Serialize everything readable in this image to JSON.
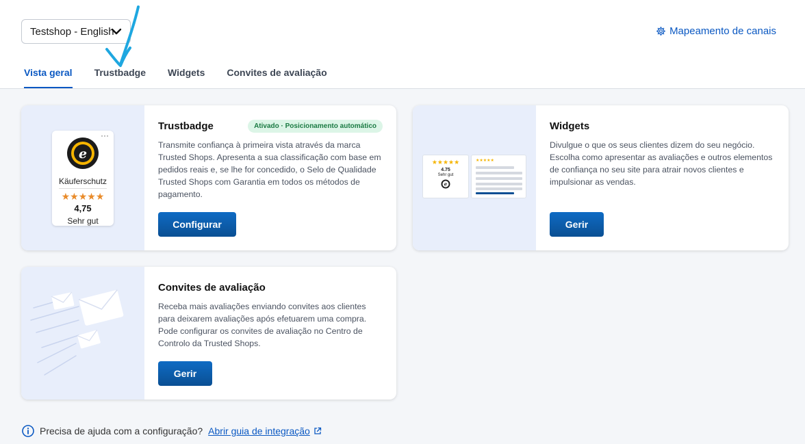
{
  "header": {
    "shop_select": "Testshop - English",
    "channel_mapping": "Mapeamento de canais"
  },
  "tabs": [
    {
      "label": "Vista geral",
      "active": true
    },
    {
      "label": "Trustbadge",
      "active": false
    },
    {
      "label": "Widgets",
      "active": false
    },
    {
      "label": "Convites de avaliação",
      "active": false
    }
  ],
  "cards": {
    "trustbadge": {
      "title": "Trustbadge",
      "badge": "Ativado · Posicionamento automático",
      "description": "Transmite confiança à primeira vista através da marca Trusted Shops. Apresenta a sua classificação com base em pedidos reais e, se lhe for concedido, o Selo de Qualidade Trusted Shops com Garantia em todos os métodos de pagamento.",
      "button": "Configurar",
      "preview": {
        "label": "Käuferschutz",
        "stars": "★★★★★",
        "score": "4,75",
        "rating": "Sehr gut"
      }
    },
    "widgets": {
      "title": "Widgets",
      "description": "Divulgue o que os seus clientes dizem do seu negócio. Escolha como apresentar as avaliações e outros elementos de confiança no seu site para atrair novos clientes e impulsionar as vendas.",
      "button": "Gerir",
      "preview": {
        "stars": "★★★★★",
        "score": "4.75",
        "rating": "Sehr gut"
      }
    },
    "invites": {
      "title": "Convites de avaliação",
      "description": "Receba mais avaliações enviando convites aos clientes para deixarem avaliações após efetuarem uma compra. Pode configurar os convites de avaliação no Centro de Controlo da Trusted Shops.",
      "button": "Gerir"
    }
  },
  "help": {
    "text": "Precisa de ajuda com a configuração?",
    "link": "Abrir guia de integração"
  },
  "colors": {
    "accent": "#0a58c2",
    "button": "#0a4f93",
    "badge_bg": "#dcf5e7",
    "badge_text": "#1b7a43",
    "visual_bg": "#e8eefb",
    "annotation_arrow": "#1ea7e0"
  }
}
